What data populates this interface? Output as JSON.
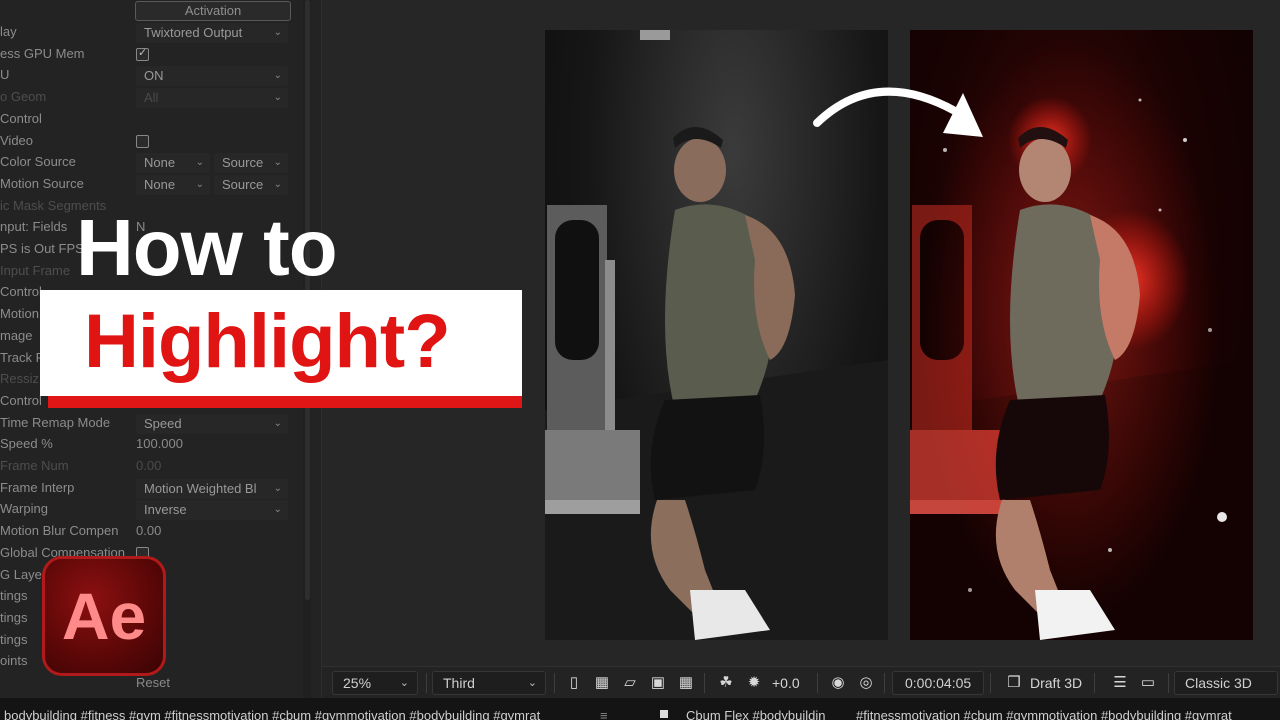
{
  "effect_panel": {
    "activation_button": "Activation",
    "rows": [
      {
        "label": "lay",
        "control": "dropdown",
        "value": "Twixtored Output",
        "dim": false
      },
      {
        "label": "ess GPU Mem",
        "control": "checkbox",
        "checked": true,
        "dim": false
      },
      {
        "label": "U",
        "control": "dropdown",
        "value": "ON",
        "dim": false
      },
      {
        "label": "o Geom",
        "control": "dropdown",
        "value": "All",
        "dim": true
      },
      {
        "label": "Control",
        "control": "none",
        "dim": false
      },
      {
        "label": "Video",
        "control": "checkbox",
        "checked": false,
        "dim": false
      },
      {
        "label": "Color Source",
        "control": "double",
        "value": "None",
        "value2": "Source",
        "dim": false
      },
      {
        "label": "Motion Source",
        "control": "double",
        "value": "None",
        "value2": "Source",
        "dim": false
      },
      {
        "label": "ic Mask Segments",
        "control": "text",
        "value": "",
        "dim": true
      },
      {
        "label": "nput: Fields",
        "control": "text",
        "value": "N",
        "dim": false
      },
      {
        "label": "PS is Out FPS",
        "control": "none",
        "dim": false
      },
      {
        "label": "Input Frame",
        "control": "none",
        "dim": true
      },
      {
        "label": "Control",
        "control": "none",
        "dim": false
      },
      {
        "label": "Motion",
        "control": "none",
        "dim": false
      },
      {
        "label": "mage",
        "control": "none",
        "dim": false
      },
      {
        "label": "Track R",
        "control": "none",
        "dim": false
      },
      {
        "label": "Ressiz",
        "control": "none",
        "dim": true
      },
      {
        "label": "Control",
        "control": "none",
        "dim": false
      },
      {
        "label": "Time Remap Mode",
        "control": "dropdown",
        "value": "Speed",
        "dim": false
      },
      {
        "label": "Speed %",
        "control": "text",
        "value": "100.000",
        "dim": false
      },
      {
        "label": "Frame Num",
        "control": "text",
        "value": "0.00",
        "dim": true
      },
      {
        "label": "Frame Interp",
        "control": "dropdown",
        "value": "Motion Weighted Bl",
        "dim": false
      },
      {
        "label": "Warping",
        "control": "dropdown",
        "value": "Inverse",
        "dim": false
      },
      {
        "label": "Motion Blur Compen",
        "control": "text",
        "value": "0.00",
        "dim": false
      },
      {
        "label": "Global Compensation",
        "control": "checkbox",
        "checked": false,
        "dim": false
      },
      {
        "label": "G Layer",
        "control": "none",
        "dim": false
      },
      {
        "label": "tings",
        "control": "none",
        "dim": false
      },
      {
        "label": "tings",
        "control": "none",
        "dim": false
      },
      {
        "label": "tings",
        "control": "none",
        "dim": false
      },
      {
        "label": "oints",
        "control": "none",
        "dim": false
      },
      {
        "label": "",
        "control": "text",
        "value": "Reset",
        "dim": false
      }
    ]
  },
  "overlay": {
    "title_line1": "How to",
    "title_line2": "Highlight?",
    "logo_text": "Ae",
    "accent_color": "#e11414"
  },
  "toolbar": {
    "zoom": "25%",
    "resolution": "Third",
    "exposure": "+0.0",
    "timecode": "0:00:04:05",
    "renderer": "Draft 3D",
    "renderer_mode": "Classic 3D"
  },
  "tags": {
    "left": "bodybuilding #fitness #gym #fitnessmotivation #cbum #gymmotivation #bodybuilding #gymrat",
    "title": "Cbum Flex #bodybuildin",
    "right": "#fitnessmotivation #cbum #gymmotivation #bodybuilding #gymrat"
  }
}
